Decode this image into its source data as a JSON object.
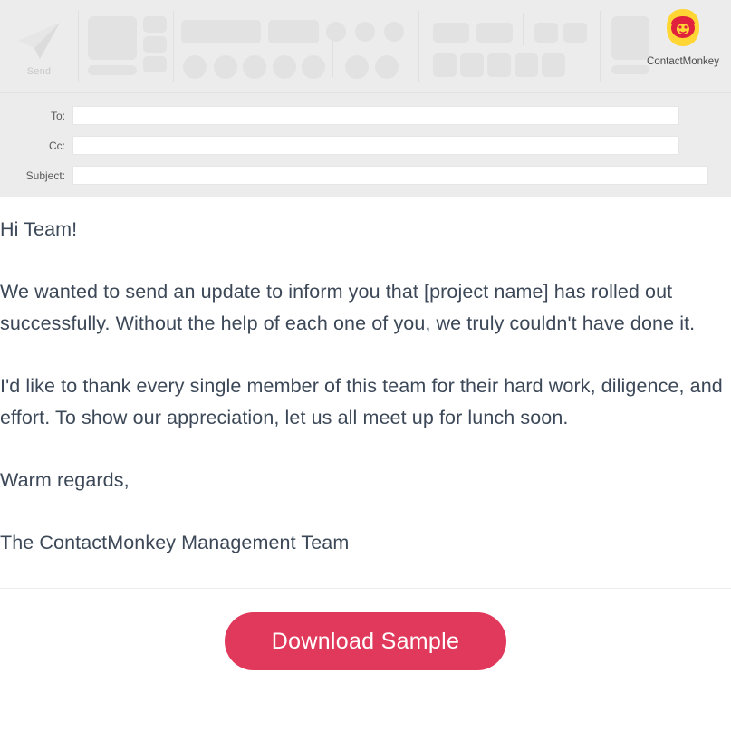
{
  "window": {
    "type": "email-compose",
    "chrome_bg": "#ececec",
    "body_bg": "#ffffff"
  },
  "ribbon": {
    "send": {
      "label": "Send",
      "icon": "paper-plane-icon"
    },
    "placeholder_groups": [
      {
        "name": "clipboard-group"
      },
      {
        "name": "basic-text-group"
      },
      {
        "name": "names-group"
      },
      {
        "name": "include-group"
      },
      {
        "name": "addin-group"
      }
    ]
  },
  "fields": {
    "to": {
      "label": "To:",
      "value": "",
      "placeholder": ""
    },
    "cc": {
      "label": "Cc:",
      "value": "",
      "placeholder": ""
    },
    "subject": {
      "label": "Subject:",
      "value": "",
      "placeholder": ""
    }
  },
  "brand": {
    "name": "ContactMonkey",
    "logo_bg": "#ffd633",
    "logo_fg": "#e1223f"
  },
  "email": {
    "greeting": "Hi Team!",
    "paragraph_1": "We wanted to send an update to inform you that [project name] has rolled out successfully. Without the help of each one of you, we truly couldn't have done it.",
    "paragraph_2": "I'd like to thank every single member of this team for their hard work, diligence, and effort. To show our appreciation, let us all meet up for lunch soon.",
    "signoff": "Warm regards,",
    "signature": "The ContactMonkey Management Team"
  },
  "cta": {
    "label": "Download Sample",
    "color": "#e1395b",
    "text_color": "#ffffff"
  }
}
